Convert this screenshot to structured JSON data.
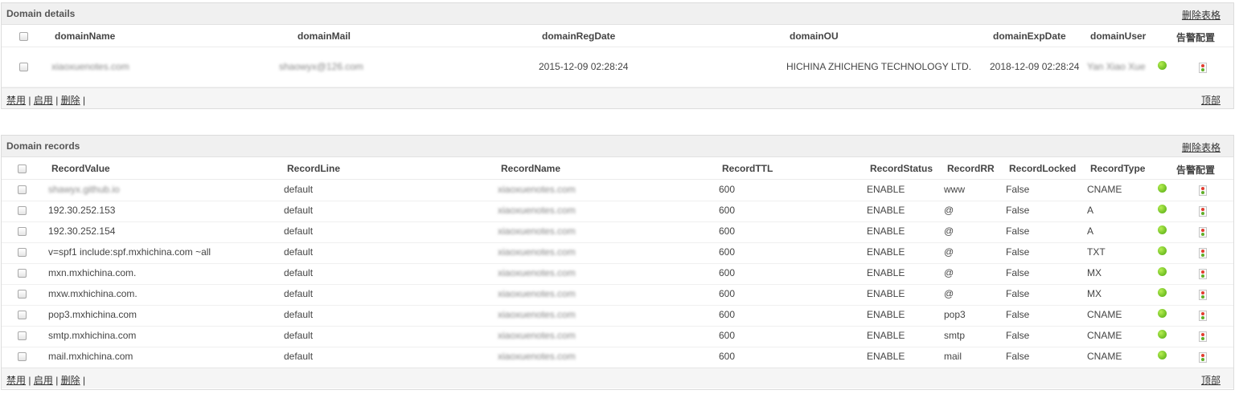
{
  "domain_panel": {
    "title": "Domain details",
    "delete_table_label": "删除表格",
    "alarm_header": "告警配置",
    "columns": [
      "domainName",
      "domainMail",
      "domainRegDate",
      "domainOU",
      "domainExpDate",
      "domainUser"
    ],
    "row": {
      "domainName": "xiaoxuenotes.com",
      "domainMail": "shaowyx@126.com",
      "domainRegDate": "2015-12-09 02:28:24",
      "domainOU": "HICHINA ZHICHENG TECHNOLOGY LTD.",
      "domainExpDate": "2018-12-09 02:28:24",
      "domainUser": "Yan Xiao Xue"
    },
    "footer": {
      "disable": "禁用",
      "enable": "启用",
      "delete": "删除",
      "sep": "|",
      "top": "顶部"
    }
  },
  "records_panel": {
    "title": "Domain records",
    "delete_table_label": "删除表格",
    "alarm_header": "告警配置",
    "columns": [
      "RecordValue",
      "RecordLine",
      "RecordName",
      "RecordTTL",
      "RecordStatus",
      "RecordRR",
      "RecordLocked",
      "RecordType"
    ],
    "rows": [
      {
        "value": "shawyx.github.io",
        "line": "default",
        "name": "xiaoxuenotes.com",
        "ttl": "600",
        "status": "ENABLE",
        "rr": "www",
        "locked": "False",
        "type": "CNAME"
      },
      {
        "value": "192.30.252.153",
        "line": "default",
        "name": "xiaoxuenotes.com",
        "ttl": "600",
        "status": "ENABLE",
        "rr": "@",
        "locked": "False",
        "type": "A"
      },
      {
        "value": "192.30.252.154",
        "line": "default",
        "name": "xiaoxuenotes.com",
        "ttl": "600",
        "status": "ENABLE",
        "rr": "@",
        "locked": "False",
        "type": "A"
      },
      {
        "value": "v=spf1 include:spf.mxhichina.com ~all",
        "line": "default",
        "name": "xiaoxuenotes.com",
        "ttl": "600",
        "status": "ENABLE",
        "rr": "@",
        "locked": "False",
        "type": "TXT"
      },
      {
        "value": "mxn.mxhichina.com.",
        "line": "default",
        "name": "xiaoxuenotes.com",
        "ttl": "600",
        "status": "ENABLE",
        "rr": "@",
        "locked": "False",
        "type": "MX"
      },
      {
        "value": "mxw.mxhichina.com.",
        "line": "default",
        "name": "xiaoxuenotes.com",
        "ttl": "600",
        "status": "ENABLE",
        "rr": "@",
        "locked": "False",
        "type": "MX"
      },
      {
        "value": "pop3.mxhichina.com",
        "line": "default",
        "name": "xiaoxuenotes.com",
        "ttl": "600",
        "status": "ENABLE",
        "rr": "pop3",
        "locked": "False",
        "type": "CNAME"
      },
      {
        "value": "smtp.mxhichina.com",
        "line": "default",
        "name": "xiaoxuenotes.com",
        "ttl": "600",
        "status": "ENABLE",
        "rr": "smtp",
        "locked": "False",
        "type": "CNAME"
      },
      {
        "value": "mail.mxhichina.com",
        "line": "default",
        "name": "xiaoxuenotes.com",
        "ttl": "600",
        "status": "ENABLE",
        "rr": "mail",
        "locked": "False",
        "type": "CNAME"
      }
    ],
    "footer": {
      "disable": "禁用",
      "enable": "启用",
      "delete": "删除",
      "sep": "|",
      "top": "顶部"
    }
  },
  "icons": {
    "status": "green-status-dot-icon",
    "alarm": "traffic-light-alarm-icon"
  },
  "colors": {
    "status_green": "#4ea80d",
    "header_bg": "#f0f0f0",
    "alarm_red": "#e33b2e"
  }
}
